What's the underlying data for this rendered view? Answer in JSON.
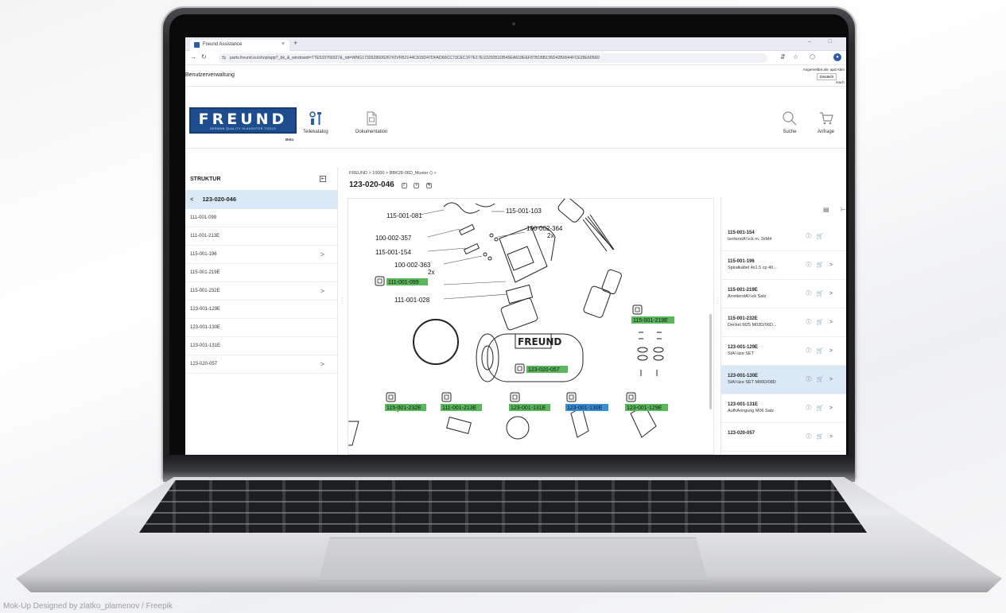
{
  "browser": {
    "tab_title": "Freund Assistance",
    "tab_close": "×",
    "new_tab": "+",
    "window_controls": "– □",
    "url": "parts.freund.eu/shop/app?_bk_&_windowid=TTE533769327&_rid=WNG1732628606267#2VFB2144C915D47DFAD66CC73CEC1F7E17E1D29351DB45EA618EEF87B1BB136D42B0044FCE28E6056D"
  },
  "app": {
    "section_title": "Benutzerverwaltung",
    "login_text": "Angemeldet als: apd Abm",
    "language": "Deutsch",
    "language_extra": "Nach",
    "logo": {
      "brand": "FREUND",
      "subtitle": "GERMAN QUALITY SLAUGHTER-TOOLS",
      "badge": "Beta"
    },
    "nav": {
      "catalog": "Teilekatalog",
      "docs": "Dokumentation",
      "search": "Suche",
      "request": "Anfrage"
    }
  },
  "sidebar": {
    "title": "STRUKTUR",
    "selected": "123-020-046",
    "items": [
      {
        "label": "111-001-099",
        "has_children": false
      },
      {
        "label": "111-001-213E",
        "has_children": false
      },
      {
        "label": "115-001-196",
        "has_children": true
      },
      {
        "label": "115-001-219E",
        "has_children": false
      },
      {
        "label": "115-001-232E",
        "has_children": true
      },
      {
        "label": "123-001-129E",
        "has_children": false
      },
      {
        "label": "123-001-130E",
        "has_children": false
      },
      {
        "label": "123-001-131E",
        "has_children": false
      },
      {
        "label": "123-020-057",
        "has_children": true
      }
    ]
  },
  "main": {
    "breadcrumb": "FREUND > 10000 > BBK28-06D_Muster () >",
    "title": "123-020-046"
  },
  "drawing": {
    "labels": {
      "l1": "115-001-081",
      "l2": "115-001-103",
      "l3": "100-002-357",
      "l4": "100-002-364",
      "l4qty": "2x",
      "l5": "115-001-154",
      "l6": "100-002-363",
      "l6qty": "2x",
      "l8": "111-001-028"
    },
    "tags": {
      "t1": "111-001-099",
      "t2": "115-001-219E",
      "t3": "123-020-057",
      "b1": "115-001-232E",
      "b2": "111-001-213E",
      "b3": "123-001-131E",
      "b4": "123-001-130E",
      "b5": "123-001-129E"
    },
    "tag_color": "#5cb85c",
    "tag_selected_color": "#3a8fd9"
  },
  "rpanel": {
    "items": [
      {
        "code": "115-001-154",
        "desc": "IsolierstÃ¼ck m. 3xM4",
        "has_children": false,
        "selected": false
      },
      {
        "code": "115-001-196",
        "desc": "Spiralkabel 4x1.5 cp 40...",
        "has_children": true,
        "selected": false
      },
      {
        "code": "115-001-219E",
        "desc": "ArretierstÃ¼ck Satz",
        "has_children": true,
        "selected": false
      },
      {
        "code": "115-001-232E",
        "desc": "Deckel M25 M03D/06D...",
        "has_children": true,
        "selected": false
      },
      {
        "code": "123-001-129E",
        "desc": "StÃ¼tze SET",
        "has_children": true,
        "selected": false
      },
      {
        "code": "123-001-130E",
        "desc": "StÃ¼tze SET M06D/08D",
        "has_children": true,
        "selected": true
      },
      {
        "code": "123-001-131E",
        "desc": "AufhÃ¤ngung M06 Satz",
        "has_children": true,
        "selected": false
      },
      {
        "code": "123-020-057",
        "desc": "",
        "has_children": true,
        "selected": false
      }
    ]
  },
  "credit": "Mok-Up Designed by zlatko_plamenov / Freepik"
}
